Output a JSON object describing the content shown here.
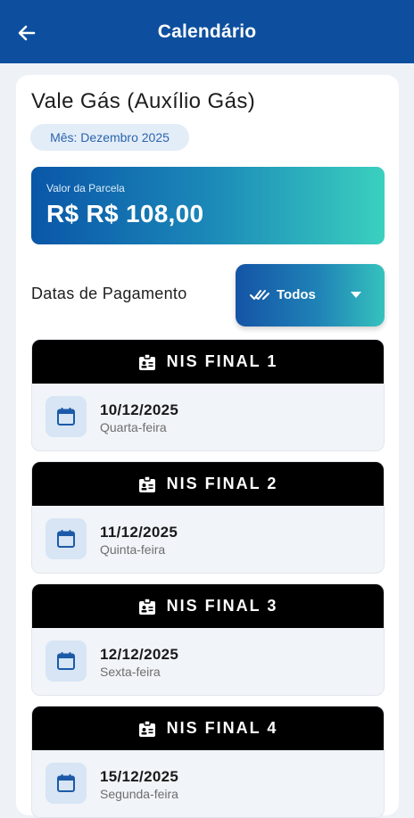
{
  "header": {
    "title": "Calendário",
    "back_icon": "arrow-left-icon"
  },
  "benefit": {
    "title": "Vale Gás (Auxílio Gás)",
    "month_chip": "Mês: Dezembro 2025"
  },
  "value_banner": {
    "label": "Valor da Parcela",
    "amount": "R$ R$ 108,00"
  },
  "payments": {
    "section_label": "Datas de Pagamento",
    "filter": {
      "label": "Todos",
      "check_icon": "double-check-icon",
      "caret_icon": "caret-down-icon"
    },
    "items": [
      {
        "nis": "NIS FINAL 1",
        "date": "10/12/2025",
        "weekday": "Quarta-feira"
      },
      {
        "nis": "NIS FINAL 2",
        "date": "11/12/2025",
        "weekday": "Quinta-feira"
      },
      {
        "nis": "NIS FINAL 3",
        "date": "12/12/2025",
        "weekday": "Sexta-feira"
      },
      {
        "nis": "NIS FINAL 4",
        "date": "15/12/2025",
        "weekday": "Segunda-feira"
      }
    ]
  },
  "colors": {
    "app_bar": "#0d4f9e",
    "chip_bg": "#e3edf8",
    "chip_text": "#2c64ad",
    "nis_header": "#000000",
    "calendar_icon": "#1c5aa8"
  }
}
